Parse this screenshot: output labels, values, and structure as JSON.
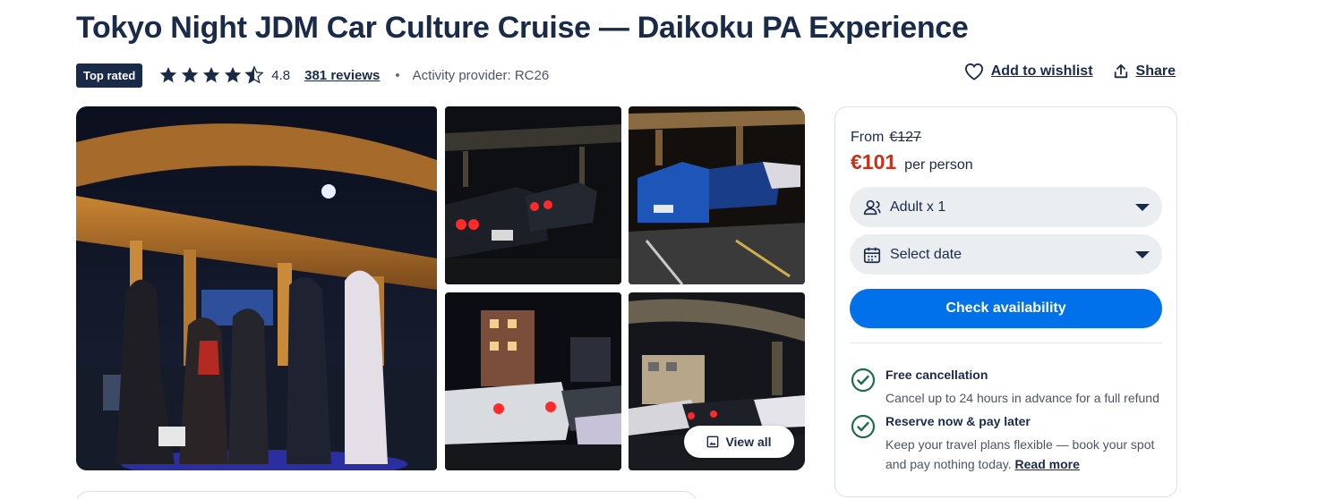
{
  "title": "Tokyo Night JDM Car Culture Cruise — Daikoku PA Experience",
  "meta": {
    "badge": "Top rated",
    "rating_value": 4.8,
    "rating_text": "4.8",
    "reviews": "381 reviews",
    "separator": "•",
    "provider": "Activity provider: RC26"
  },
  "actions": {
    "wishlist": "Add to wishlist",
    "share": "Share"
  },
  "gallery": {
    "view_all": "View all",
    "photos": [
      "Night gathering under highway",
      "Car tail lights in lot",
      "Blue race cars parked",
      "Traffic with red tail lights",
      "Cars under overpass"
    ]
  },
  "booking": {
    "from_label": "From",
    "old_price": "€127",
    "price": "€101",
    "per": "per person",
    "travellers": "Adult x 1",
    "date_placeholder": "Select date",
    "cta": "Check availability",
    "features": [
      {
        "title": "Free cancellation",
        "desc": "Cancel up to 24 hours in advance for a full refund"
      },
      {
        "title": "Reserve now & pay later",
        "desc": "Keep your travel plans flexible — book your spot and pay nothing today.",
        "link": "Read more"
      }
    ]
  },
  "colors": {
    "navy": "#1a2b49",
    "primary": "#0071eb",
    "price": "#c5311c",
    "success": "#008768"
  },
  "icons": [
    "star-icon",
    "heart-icon",
    "share-icon",
    "image-icon",
    "traveller-icon",
    "calendar-icon",
    "check-circle-icon"
  ]
}
